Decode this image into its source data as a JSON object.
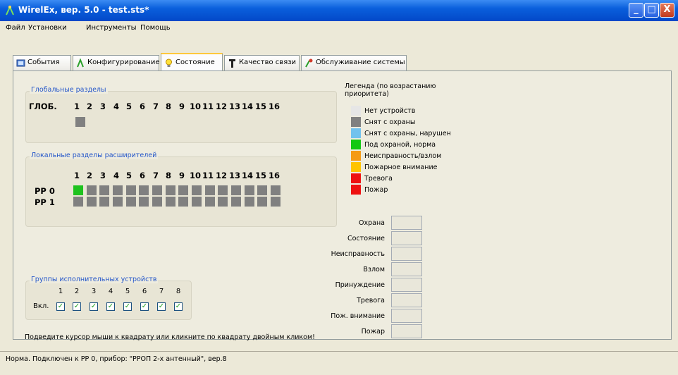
{
  "window": {
    "title": "WirelEx, вер. 5.0 - test.sts*",
    "buttons": {
      "minimize": "_",
      "maximize": "□",
      "close": "X"
    }
  },
  "menu": [
    "Файл",
    "Установки",
    "Инструменты",
    "Помощь"
  ],
  "tabs": [
    {
      "label": "События",
      "icon": "events-icon"
    },
    {
      "label": "Конфигурирование",
      "icon": "config-icon"
    },
    {
      "label": "Состояние",
      "icon": "lightbulb-icon",
      "active": true
    },
    {
      "label": "Качество связи",
      "icon": "antenna-icon"
    },
    {
      "label": "Обслуживание системы",
      "icon": "maintenance-icon"
    }
  ],
  "global": {
    "title": "Глобальные разделы",
    "row_label": "ГЛОБ.",
    "numbers": [
      "1",
      "2",
      "3",
      "4",
      "5",
      "6",
      "7",
      "8",
      "9",
      "10",
      "11",
      "12",
      "13",
      "14",
      "15",
      "16"
    ]
  },
  "local": {
    "title": "Локальные разделы расширителей",
    "numbers": [
      "1",
      "2",
      "3",
      "4",
      "5",
      "6",
      "7",
      "8",
      "9",
      "10",
      "11",
      "12",
      "13",
      "14",
      "15",
      "16"
    ],
    "rows": [
      {
        "label": "РР 0"
      },
      {
        "label": "РР 1"
      }
    ]
  },
  "groups": {
    "title": "Группы исполнительных устройств",
    "numbers": [
      "1",
      "2",
      "3",
      "4",
      "5",
      "6",
      "7",
      "8"
    ],
    "row_label": "Вкл.",
    "check": "✓"
  },
  "legend": {
    "title": "Легенда (по возрастанию приоритета)",
    "items": [
      {
        "label": "Нет устройств",
        "color": "#e6e6e6"
      },
      {
        "label": "Снят с охраны",
        "color": "#808080"
      },
      {
        "label": "Снят с охраны, нарушен",
        "color": "#72c2ee"
      },
      {
        "label": "Под охраной, норма",
        "color": "#13c813"
      },
      {
        "label": "Неисправность/взлом",
        "color": "#f59a14"
      },
      {
        "label": "Пожарное внимание",
        "color": "#ffc400"
      },
      {
        "label": "Тревога",
        "color": "#ee1111"
      },
      {
        "label": "Пожар",
        "color": "#ee1111"
      }
    ]
  },
  "states": [
    "Охрана",
    "Состояние",
    "Неисправность",
    "Взлом",
    "Принуждение",
    "Тревога",
    "Пож. внимание",
    "Пожар"
  ],
  "hint": "Подведите курсор мыши к квадрату или кликните по квадрату двойным кликом!",
  "status": "Норма.  Подключен к РР 0, прибор: \"РРОП 2-х антенный\", вер.8"
}
